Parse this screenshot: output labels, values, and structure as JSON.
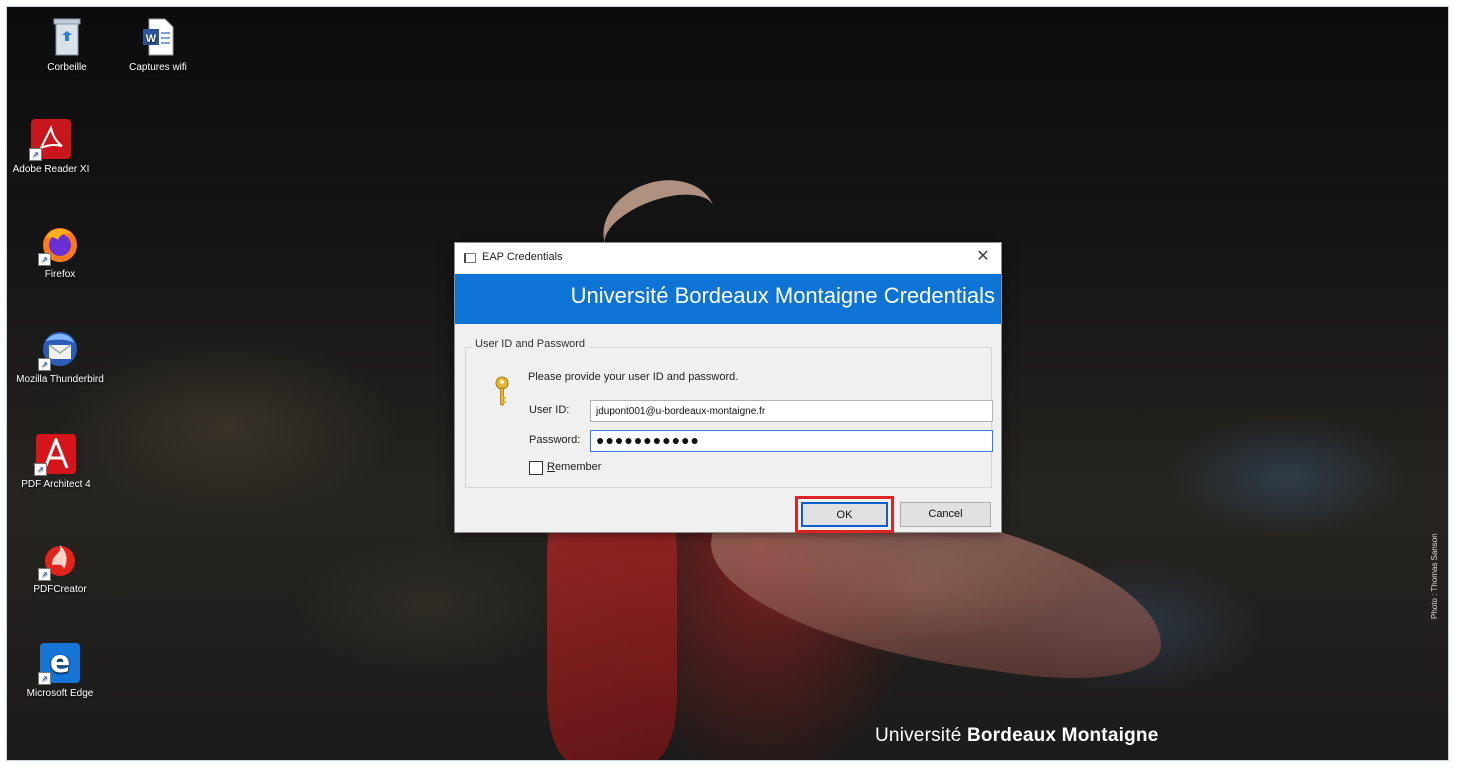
{
  "desktop": {
    "icons": [
      {
        "label": "Corbeille",
        "icon": "recycle-bin-icon"
      },
      {
        "label": "Captures wifi",
        "icon": "word-document-icon"
      },
      {
        "label": "Adobe Reader XI",
        "icon": "adobe-reader-icon"
      },
      {
        "label": "Firefox",
        "icon": "firefox-icon"
      },
      {
        "label": "Mozilla Thunderbird",
        "icon": "thunderbird-icon"
      },
      {
        "label": "PDF Architect 4",
        "icon": "pdf-architect-icon"
      },
      {
        "label": "PDFCreator",
        "icon": "pdfcreator-icon"
      },
      {
        "label": "Microsoft Edge",
        "icon": "edge-icon"
      }
    ],
    "watermark": {
      "regular": "Université ",
      "bold": "Bordeaux Montaigne"
    },
    "photo_credit": "Photo : Thomas Sanson"
  },
  "dialog": {
    "title": "EAP Credentials",
    "close_glyph": "✕",
    "banner": "Université Bordeaux Montaigne Credentials",
    "group_label": "User ID and Password",
    "instruction": "Please provide your user ID and password.",
    "userid_label": "User ID:",
    "userid_value": "jdupont001@u-bordeaux-montaigne.fr",
    "password_label": "Password:",
    "password_value": "●●●●●●●●●●●",
    "remember_access_key": "R",
    "remember_rest": "emember",
    "remember_checked": false,
    "ok_label": "OK",
    "cancel_label": "Cancel",
    "accent_color": "#0d73d4",
    "highlight_color": "#e02424"
  }
}
